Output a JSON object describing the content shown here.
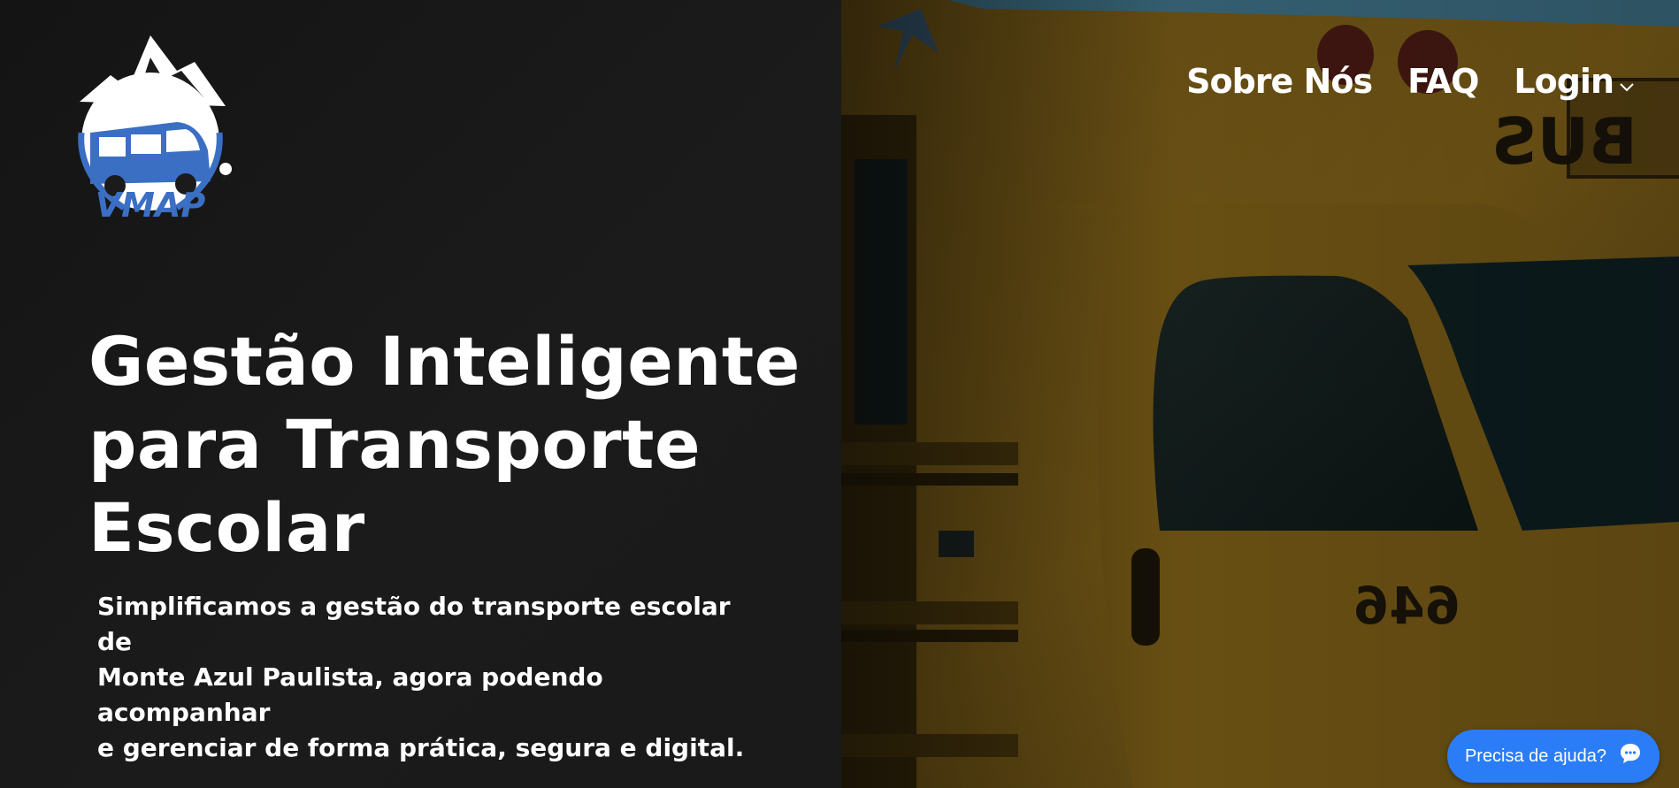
{
  "brand": {
    "logo_text": "VMAP"
  },
  "nav": {
    "items": [
      {
        "label": "Sobre Nós"
      },
      {
        "label": "FAQ"
      },
      {
        "label": "Login"
      }
    ]
  },
  "hero": {
    "title_lines": [
      "Gestão Inteligente",
      "para Transporte",
      "Escolar"
    ],
    "subtitle_lines": [
      "Simplificamos a gestão do transporte escolar",
      "de",
      "Monte Azul Paulista, agora podendo",
      "acompanhar",
      "e gerenciar de forma prática, segura e digital."
    ]
  },
  "help": {
    "label": "Precisa de ajuda?",
    "icon": "chat-bubble-icon"
  },
  "photo": {
    "bus_text": "BUS",
    "bus_number": "646"
  },
  "colors": {
    "background": "#161616",
    "accent": "#2a7df6",
    "logo_blue": "#3a6fc4",
    "bus_yellow": "#8a6a1a"
  }
}
